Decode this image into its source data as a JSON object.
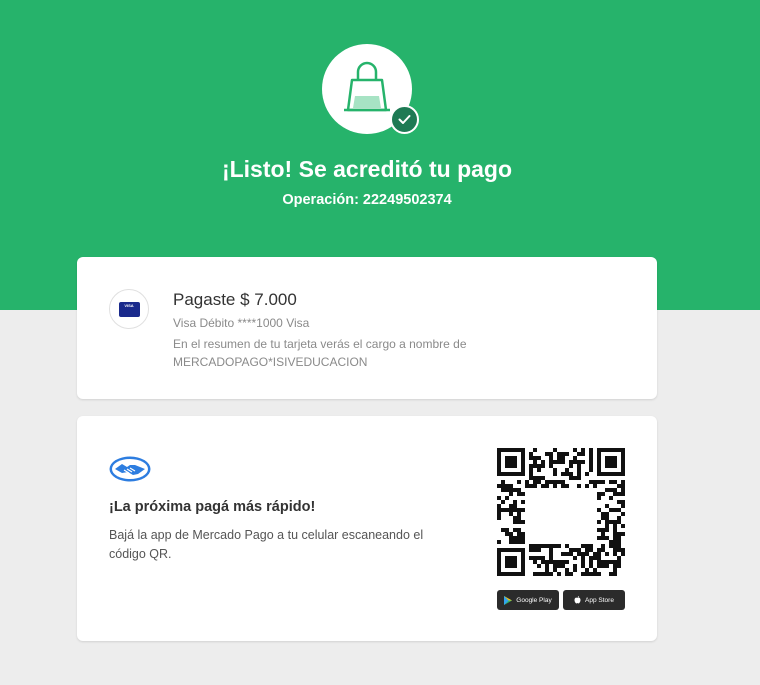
{
  "header": {
    "title": "¡Listo! Se acreditó tu pago",
    "operation": "Operación: 22249502374"
  },
  "payment": {
    "card_brand_label": "VISA",
    "amount_text": "Pagaste $ 7.000",
    "card_detail": "Visa Débito ****1000 Visa",
    "statement_text": "En el resumen de tu tarjeta verás el cargo a nombre de MERCADOPAGO*ISIVEDUCACION"
  },
  "app_promo": {
    "title": "¡La próxima pagá más rápido!",
    "description": "Bajá la app de Mercado Pago a tu celular escaneando el código QR.",
    "google_play_label": "Google Play",
    "app_store_label": "App Store"
  },
  "colors": {
    "primary_green": "#26b36b",
    "badge_green": "#1e7a54",
    "background": "#ededed"
  },
  "icons": [
    "shopping-bag-icon",
    "check-icon",
    "visa-card-icon",
    "mercado-pago-logo-icon",
    "qr-code-icon",
    "google-play-icon",
    "apple-icon"
  ]
}
